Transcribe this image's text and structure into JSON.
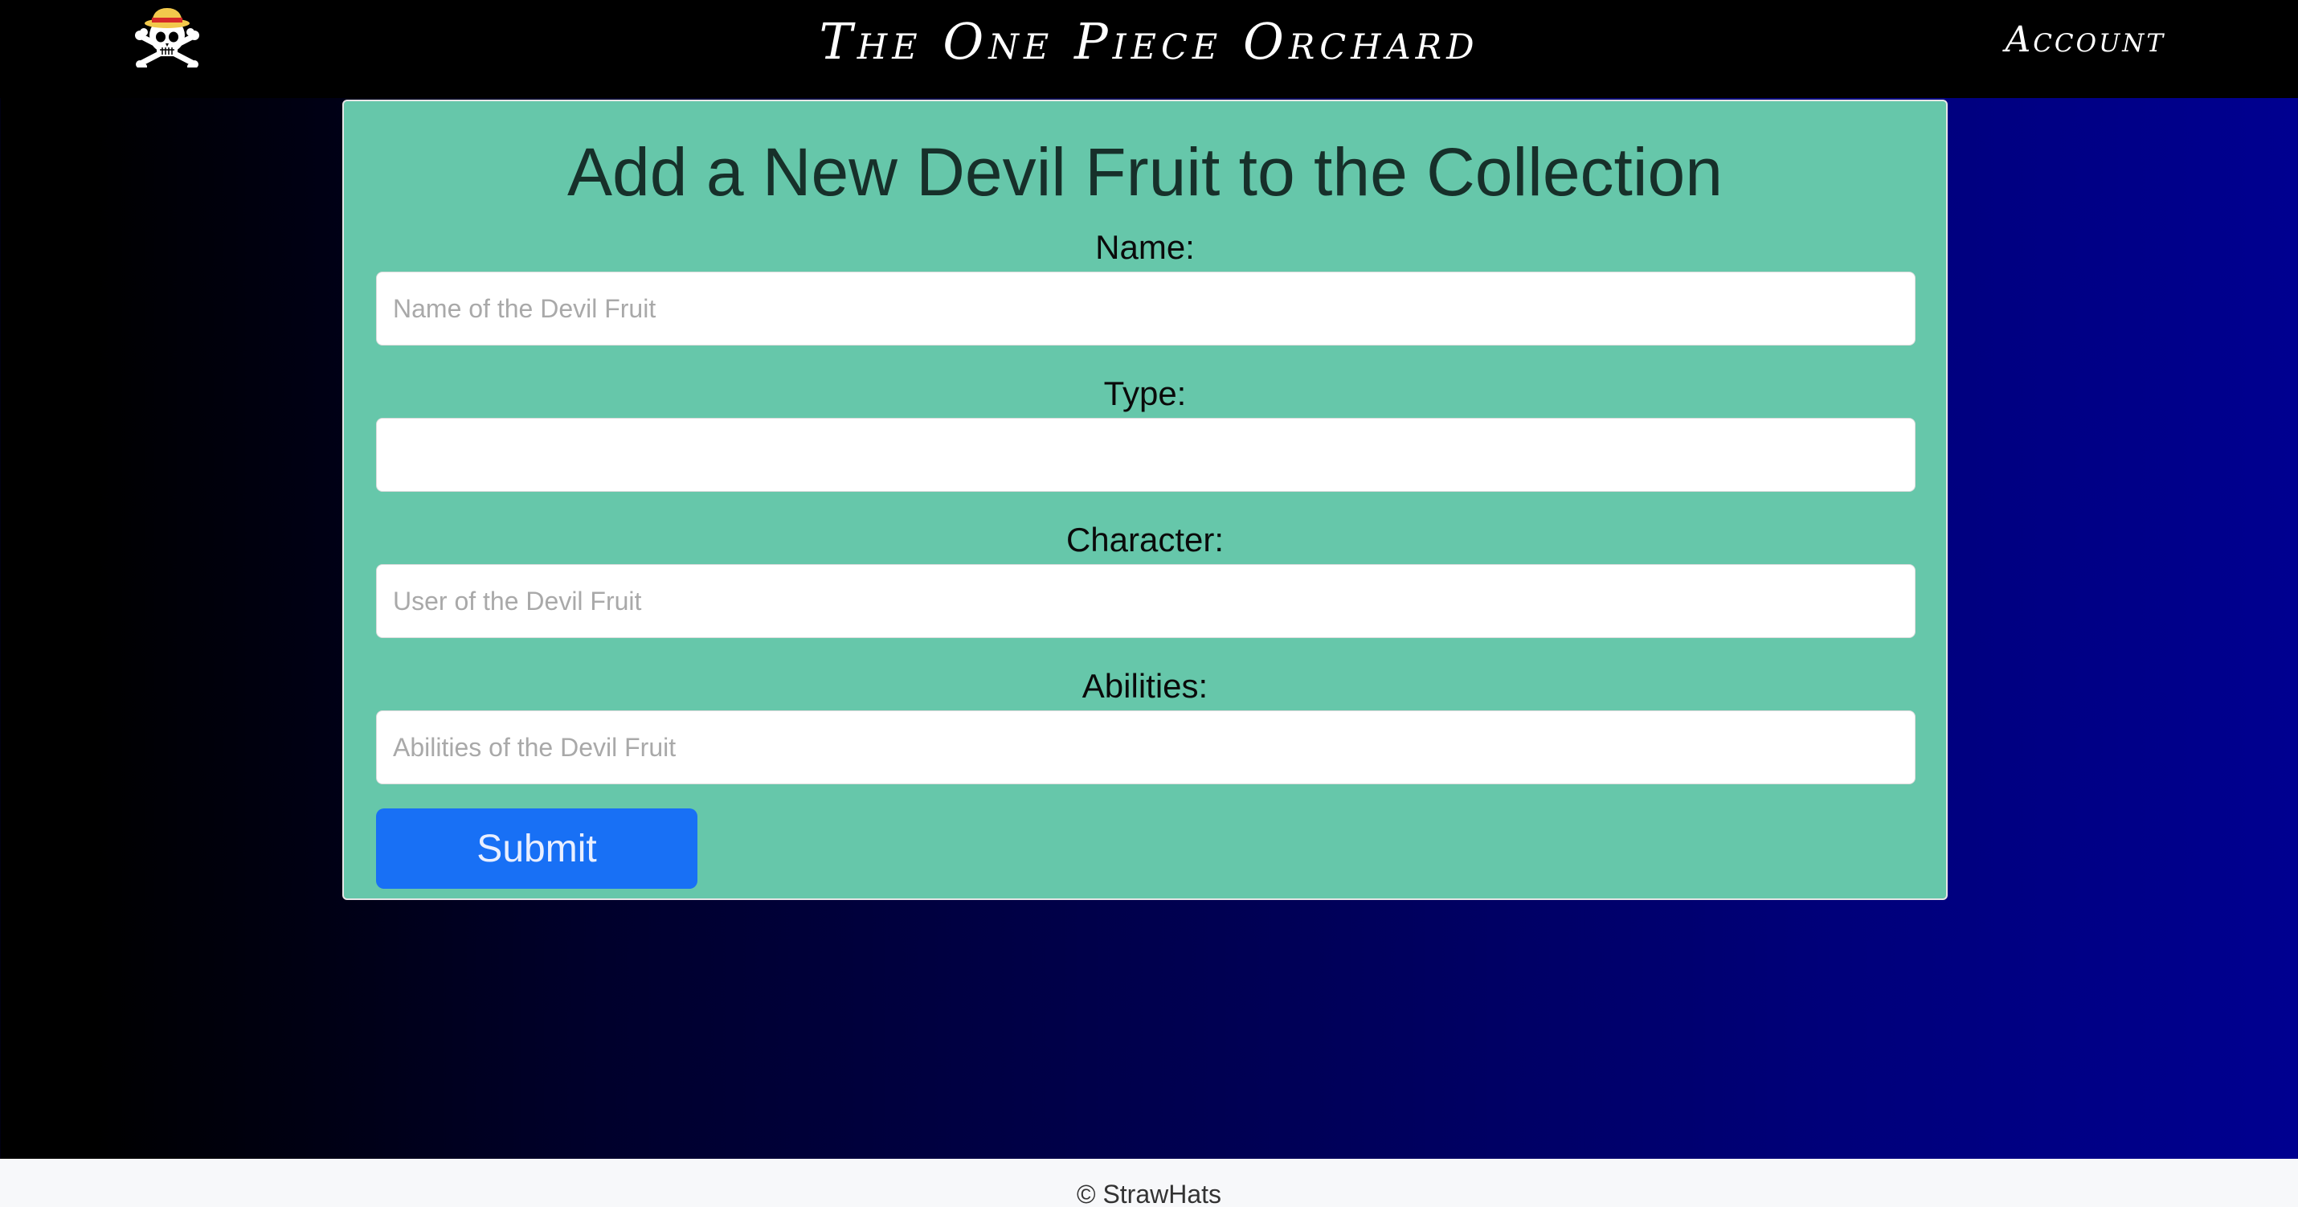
{
  "header": {
    "site_title": "The One Piece Orchard",
    "account_label": "Account",
    "logo_icon": "straw-hat-jolly-roger-icon"
  },
  "form": {
    "title": "Add a New Devil Fruit to the Collection",
    "fields": [
      {
        "label": "Name:",
        "value": "",
        "placeholder": "Name of the Devil Fruit"
      },
      {
        "label": "Type:",
        "value": "",
        "placeholder": ""
      },
      {
        "label": "Character:",
        "value": "",
        "placeholder": "User of the Devil Fruit"
      },
      {
        "label": "Abilities:",
        "value": "",
        "placeholder": "Abilities of the Devil Fruit"
      }
    ],
    "submit_label": "Submit"
  },
  "footer": {
    "text": "© StrawHats"
  },
  "colors": {
    "navbar": "#000000",
    "card": "#66c7aa",
    "submit_button": "#1870f5",
    "footer": "#f7f8fa",
    "background_gradient_end": "#000090"
  }
}
